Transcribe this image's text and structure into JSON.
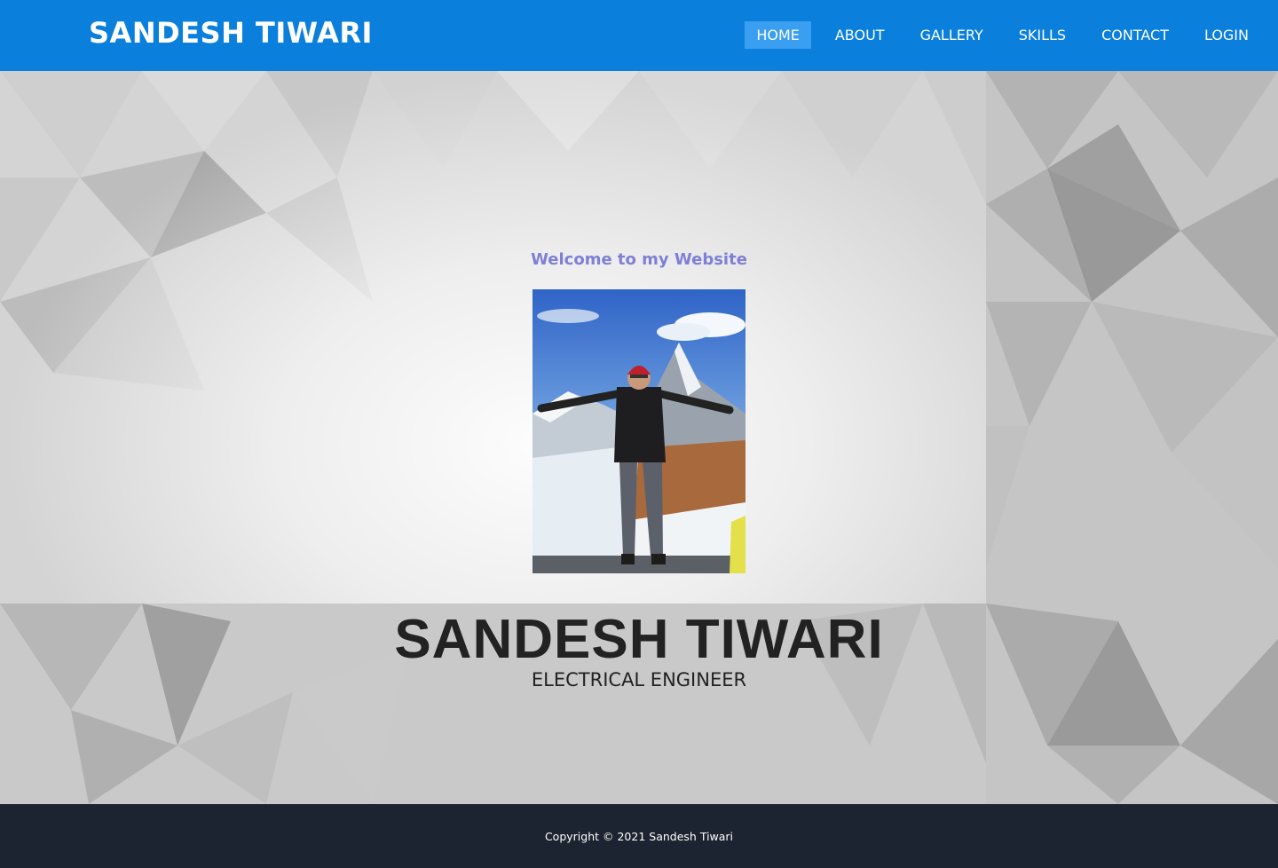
{
  "header": {
    "brand": "SANDESH TIWARI",
    "nav": [
      {
        "label": "HOME",
        "active": true
      },
      {
        "label": "ABOUT",
        "active": false
      },
      {
        "label": "GALLERY",
        "active": false
      },
      {
        "label": "SKILLS",
        "active": false
      },
      {
        "label": "CONTACT",
        "active": false
      },
      {
        "label": "LOGIN",
        "active": false
      }
    ]
  },
  "hero": {
    "welcome": "Welcome to my Website",
    "name": "SANDESH TIWARI",
    "role": "ELECTRICAL ENGINEER"
  },
  "footer": {
    "copyright": "Copyright © 2021 Sandesh Tiwari"
  },
  "colors": {
    "navbar": "#0a7fdc",
    "nav_active": "#3a9ff0",
    "welcome_text": "#7f7fd6",
    "footer_bg": "#1b2430"
  }
}
